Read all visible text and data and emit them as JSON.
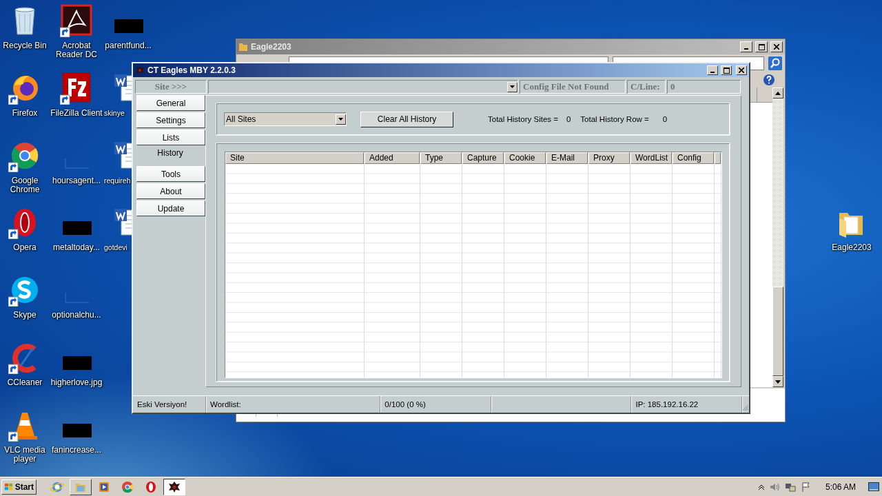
{
  "desktop": {
    "icons": [
      {
        "label": "Recycle Bin",
        "kind": "recycle-bin",
        "shortcut": false
      },
      {
        "label": "Firefox",
        "kind": "firefox",
        "shortcut": true
      },
      {
        "label": "Google Chrome",
        "kind": "chrome",
        "shortcut": true
      },
      {
        "label": "Opera",
        "kind": "opera",
        "shortcut": true
      },
      {
        "label": "Skype",
        "kind": "skype",
        "shortcut": true
      },
      {
        "label": "CCleaner",
        "kind": "ccleaner",
        "shortcut": true
      },
      {
        "label": "VLC media player",
        "kind": "vlc",
        "shortcut": true
      },
      {
        "label": "Acrobat Reader DC",
        "kind": "acrobat",
        "shortcut": true
      },
      {
        "label": "FileZilla Client",
        "kind": "filezilla",
        "shortcut": true
      },
      {
        "label": "hoursagent...",
        "kind": "blank",
        "shortcut": false
      },
      {
        "label": "metaltoday...",
        "kind": "redacted",
        "shortcut": false
      },
      {
        "label": "optionalchu...",
        "kind": "blank",
        "shortcut": false
      },
      {
        "label": "higherlove.jpg",
        "kind": "redacted",
        "shortcut": false
      },
      {
        "label": "fanincrease...",
        "kind": "redacted",
        "shortcut": false
      },
      {
        "label": "parentfund...",
        "kind": "redacted",
        "shortcut": false
      },
      {
        "label": "skinye",
        "kind": "word",
        "shortcut": false
      },
      {
        "label": "requireh",
        "kind": "word",
        "shortcut": false
      },
      {
        "label": "gotdevi",
        "kind": "word",
        "shortcut": false
      },
      {
        "label": "Eagle2203",
        "kind": "folder",
        "shortcut": false
      }
    ]
  },
  "background_window": {
    "title": "Eagle2203"
  },
  "main_window": {
    "title": "CT Eagles MBY 2.2.0.3",
    "site_label": "Site >>>",
    "config_status": "Config File Not Found",
    "cline_label": "C/Line:",
    "cline_value": "0",
    "tabs": [
      {
        "label": "General",
        "selected": false
      },
      {
        "label": "Settings",
        "selected": false
      },
      {
        "label": "Lists",
        "selected": false
      },
      {
        "label": "History",
        "selected": true
      },
      {
        "label": "Tools",
        "selected": false
      },
      {
        "label": "About",
        "selected": false
      },
      {
        "label": "Update",
        "selected": false
      }
    ],
    "filter": "All Sites",
    "clear_button": "Clear All History",
    "total_sites_label": "Total History Sites =",
    "total_sites": "0",
    "total_rows_label": "Total History Row =",
    "total_rows": "0",
    "table": {
      "columns": [
        "Site",
        "Added",
        "Type",
        "Capture",
        "Cookie",
        "E-Mail",
        "Proxy",
        "WordList",
        "Config"
      ]
    },
    "status_bar": [
      "Eski Versiyon!",
      "Wordlist:",
      "0/100 (0 %)",
      "IP:  185.192.16.22"
    ]
  },
  "taskbar": {
    "start_label": "Start",
    "apps": [
      {
        "kind": "ie",
        "running": false,
        "selected": false
      },
      {
        "kind": "explorer",
        "running": true,
        "selected": false
      },
      {
        "kind": "media",
        "running": false,
        "selected": false
      },
      {
        "kind": "chrome",
        "running": false,
        "selected": false
      },
      {
        "kind": "opera",
        "running": false,
        "selected": false
      },
      {
        "kind": "eagle",
        "running": true,
        "selected": true
      }
    ],
    "clock": "5:06 AM"
  }
}
